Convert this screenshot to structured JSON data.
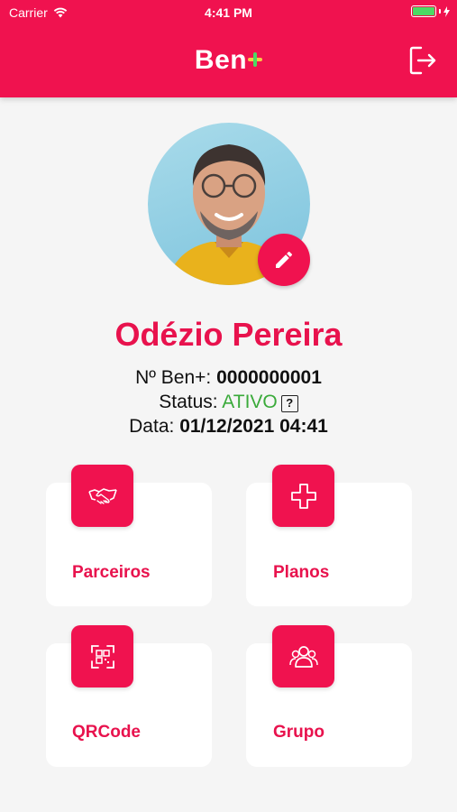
{
  "status_bar": {
    "carrier": "Carrier",
    "time": "4:41 PM"
  },
  "header": {
    "logo_text": "Ben",
    "logout_icon": "logout-icon"
  },
  "profile": {
    "name": "Odézio Pereira",
    "ben_number_label": "Nº Ben+:",
    "ben_number": "0000000001",
    "status_label": "Status:",
    "status_value": "ATIVO",
    "status_help": "?",
    "date_label": "Data:",
    "date_value": "01/12/2021 04:41"
  },
  "menu": [
    {
      "label": "Parceiros",
      "icon": "handshake-icon"
    },
    {
      "label": "Planos",
      "icon": "plus-icon"
    },
    {
      "label": "QRCode",
      "icon": "qr-scan-icon"
    },
    {
      "label": "Grupo",
      "icon": "group-icon"
    }
  ],
  "colors": {
    "primary": "#f0124f",
    "status_active": "#3aaa3a",
    "background": "#f5f5f5"
  }
}
